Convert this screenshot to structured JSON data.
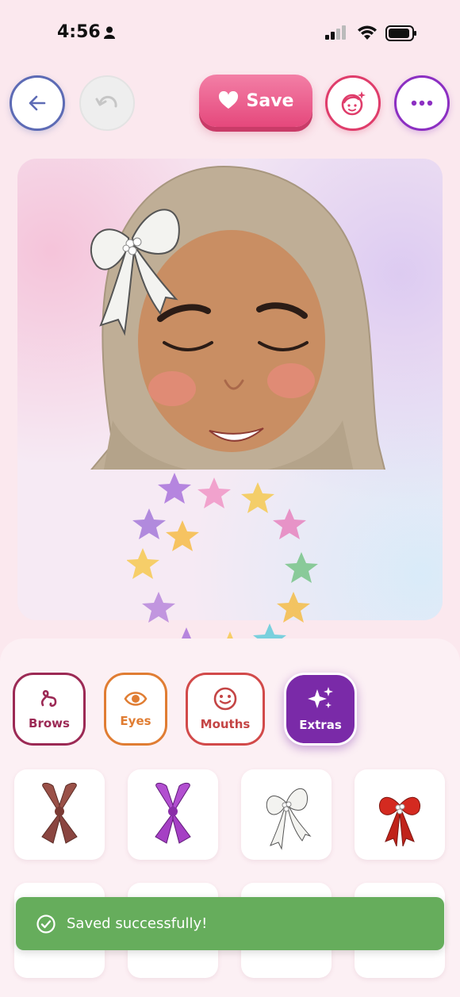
{
  "status_bar": {
    "time": "4:56"
  },
  "toolbar": {
    "save_label": "Save"
  },
  "categories": [
    {
      "label": "Brows",
      "icon": "brow-squiggle-icon"
    },
    {
      "label": "Eyes",
      "icon": "eye-icon"
    },
    {
      "label": "Mouths",
      "icon": "smile-icon"
    },
    {
      "label": "Extras",
      "icon": "sparkles-icon",
      "selected": true
    }
  ],
  "extras_items": [
    {
      "name": "brown-bow"
    },
    {
      "name": "purple-bow"
    },
    {
      "name": "white-pearl-bow"
    },
    {
      "name": "red-pearl-bow"
    }
  ],
  "toast": {
    "message": "Saved successfully!"
  },
  "colors": {
    "accent_pink": "#e5487c",
    "selected_purple": "#7a2aa8",
    "toast_green": "#66ad5c"
  }
}
